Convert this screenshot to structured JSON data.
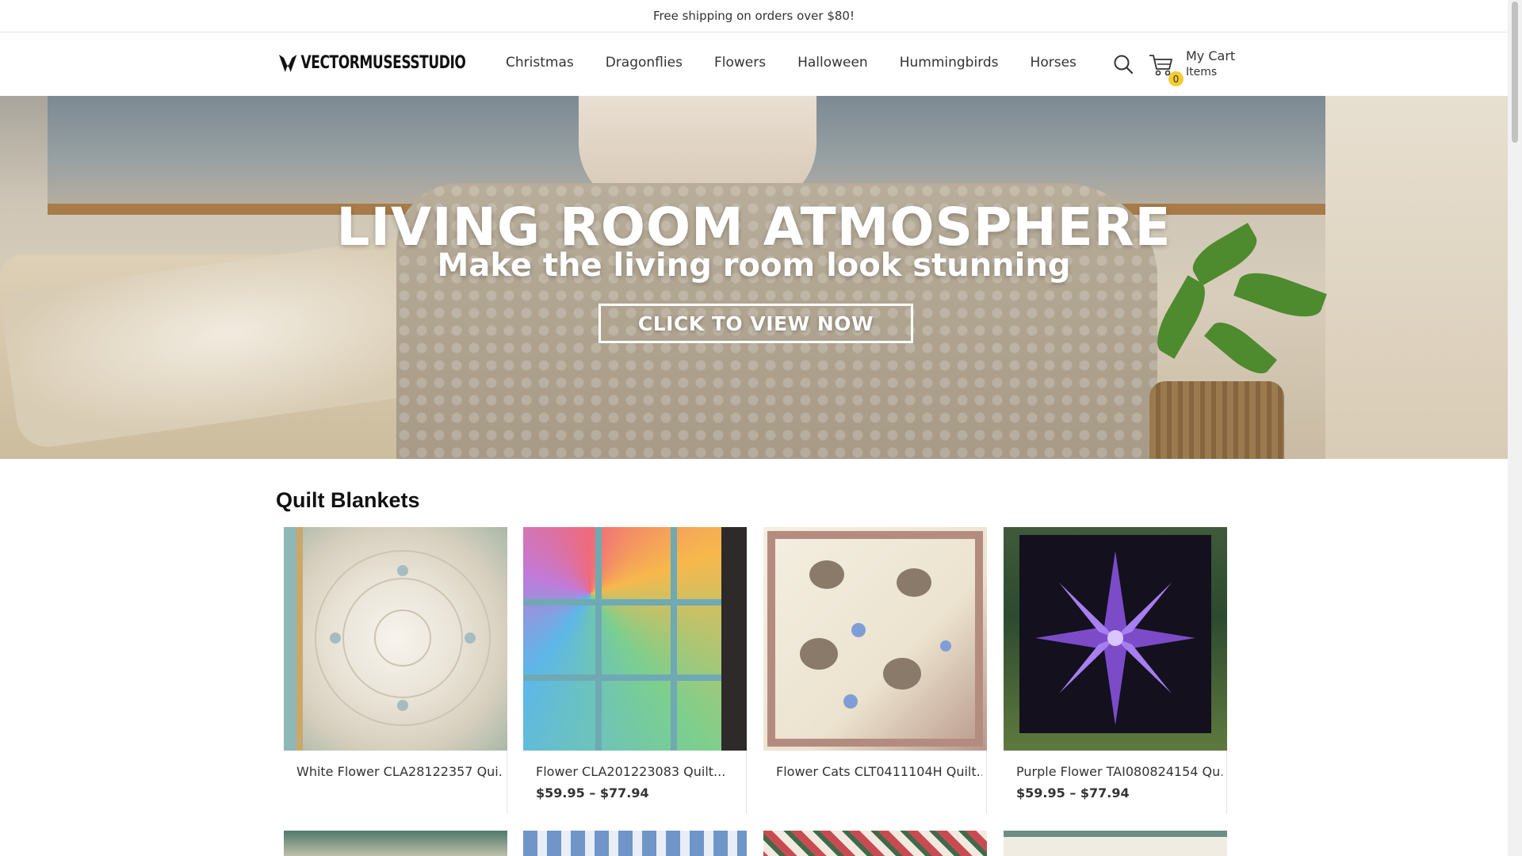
{
  "announcement": "Free shipping on orders over $80!",
  "header": {
    "logo_text": "VECTORMUSESSTUDIO",
    "nav": [
      "Christmas",
      "Dragonflies",
      "Flowers",
      "Halloween",
      "Hummingbirds",
      "Horses"
    ],
    "cart": {
      "count": "0",
      "label": "My Cart",
      "sublabel": "Items"
    },
    "icons": {
      "search": "search-icon",
      "cart": "cart-icon",
      "logo": "logo-icon"
    }
  },
  "hero": {
    "title": "LIVING ROOM ATMOSPHERE",
    "subtitle": "Make the living room look stunning",
    "button": "CLICK TO VIEW NOW"
  },
  "section": {
    "title": "Quilt Blankets",
    "products": [
      {
        "title": "White Flower CLA28122357 Qui...",
        "price": ""
      },
      {
        "title": "Flower CLA201223083 Quilt...",
        "price": "$59.95 – $77.94"
      },
      {
        "title": "Flower Cats CLT0411104H Quilt...",
        "price": ""
      },
      {
        "title": "Purple Flower TAI080824154 Qu...",
        "price": "$59.95 – $77.94"
      }
    ]
  },
  "colors": {
    "accent_badge": "#f5cc31",
    "text": "#333333",
    "border": "#e5e5e5"
  }
}
